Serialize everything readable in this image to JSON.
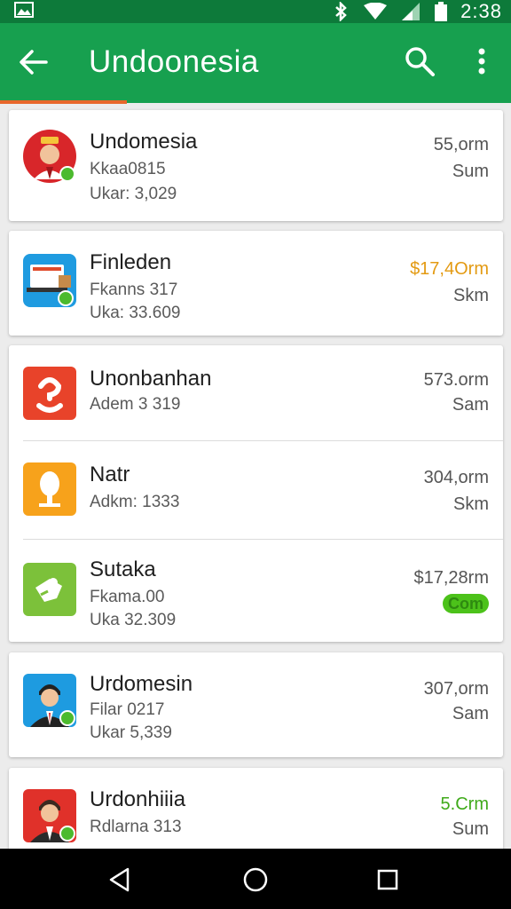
{
  "status_bar": {
    "time": "2:38"
  },
  "app_bar": {
    "title": "Undoonesia"
  },
  "cards": [
    {
      "name": "Undomesia",
      "line1": "Kkaa0815",
      "line2": "Ukar: 3,029",
      "price": "55,orm",
      "unit": "Sum",
      "price_color": "#555555",
      "icon": "doorman-avatar-icon"
    },
    {
      "name": "Finleden",
      "line1": "Fkanns 317",
      "line2": "Uka: 33.609",
      "price": "$17,4Orm",
      "unit": "Skm",
      "price_color": "#e39a12",
      "icon": "computer-shop-icon"
    },
    {
      "name": "Unonbanhan",
      "line1": "Adem 3 319",
      "line2": "",
      "price": "573.orm",
      "unit": "Sam",
      "price_color": "#555555",
      "icon": "app-red-icon"
    },
    {
      "name": "Natr",
      "line1": "Adkm: 1333",
      "line2": "",
      "price": "304,orm",
      "unit": "Skm",
      "price_color": "#555555",
      "icon": "tree-icon"
    },
    {
      "name": "Sutaka",
      "line1": "Fkama.00",
      "line2": "Uka 32.309",
      "price": "$17,28rm",
      "unit": "",
      "badge": "Com",
      "price_color": "#555555",
      "icon": "puzzle-icon"
    },
    {
      "name": "Urdomesin",
      "line1": "Filar 0217",
      "line2": "Ukar 5,339",
      "price": "307,orm",
      "unit": "Sam",
      "price_color": "#555555",
      "icon": "businessman-avatar-icon"
    },
    {
      "name": "Urdonhiiia",
      "line1": "Rdlarna 313",
      "line2": "",
      "price": "5.Crm",
      "unit": "Sum",
      "price_color": "#3faa1a",
      "icon": "man-avatar-icon"
    }
  ],
  "colors": {
    "status_bar": "#0d7a3a",
    "app_bar": "#17a04f",
    "accent": "#e8672b"
  }
}
